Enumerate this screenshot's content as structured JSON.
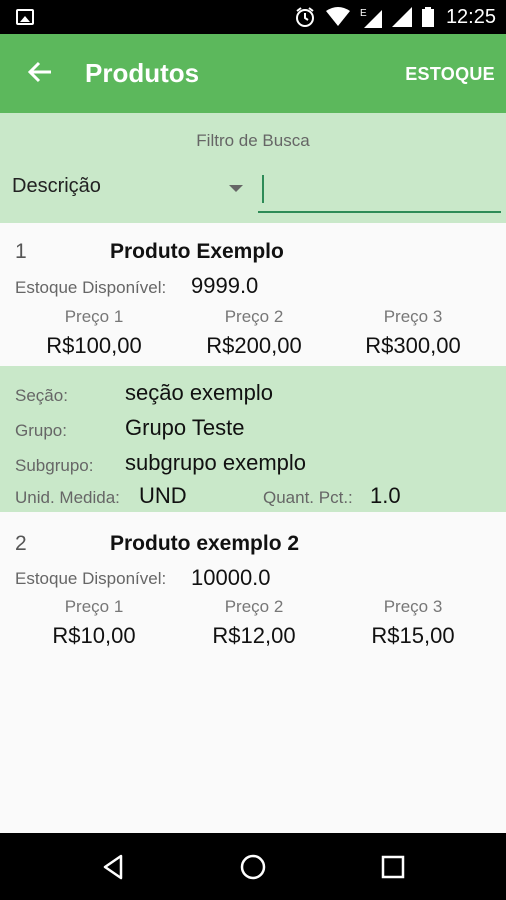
{
  "status_bar": {
    "time": "12:25"
  },
  "app_bar": {
    "title": "Produtos",
    "action": "ESTOQUE"
  },
  "filter": {
    "label": "Filtro de Busca",
    "field": "Descrição",
    "value": ""
  },
  "products": [
    {
      "index": "1",
      "name": "Produto Exemplo",
      "stock_label": "Estoque Disponível:",
      "stock_value": "9999.0",
      "prices": [
        {
          "label": "Preço 1",
          "value": "R$100,00"
        },
        {
          "label": "Preço 2",
          "value": "R$200,00"
        },
        {
          "label": "Preço 3",
          "value": "R$300,00"
        }
      ],
      "details": {
        "secao_label": "Seção:",
        "secao_value": "seção exemplo",
        "grupo_label": "Grupo:",
        "grupo_value": "Grupo Teste",
        "subgrupo_label": "Subgrupo:",
        "subgrupo_value": "subgrupo exemplo",
        "unid_label": "Unid. Medida:",
        "unid_value": "UND",
        "quant_label": "Quant. Pct.:",
        "quant_value": "1.0"
      }
    },
    {
      "index": "2",
      "name": "Produto exemplo 2",
      "stock_label": "Estoque Disponível:",
      "stock_value": "10000.0",
      "prices": [
        {
          "label": "Preço 1",
          "value": "R$10,00"
        },
        {
          "label": "Preço 2",
          "value": "R$12,00"
        },
        {
          "label": "Preço 3",
          "value": "R$15,00"
        }
      ]
    }
  ],
  "colors": {
    "primary": "#5cb85c",
    "highlight": "#c9e8c9",
    "accent": "#2e8b57"
  }
}
